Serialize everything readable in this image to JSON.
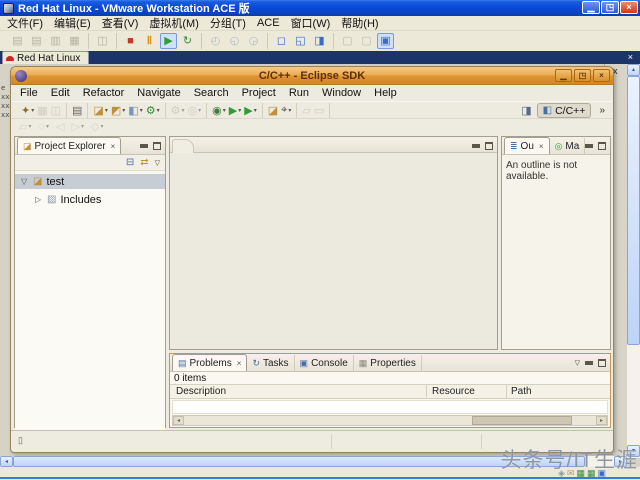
{
  "vmware": {
    "title": "Red Hat Linux - VMware Workstation ACE 版",
    "window_buttons": {
      "minimize": "▁",
      "restore": "◳",
      "close": "×"
    },
    "menu_items": [
      "文件(F)",
      "编辑(E)",
      "查看(V)",
      "虚拟机(M)",
      "分组(T)",
      "ACE",
      "窗口(W)",
      "帮助(H)"
    ],
    "toolbar": {
      "g1": [
        {
          "name": "vm-tool-icon-1",
          "glyph": "▤",
          "color": "#8a867a",
          "cls": "dim"
        },
        {
          "name": "vm-tool-icon-2",
          "glyph": "▤",
          "color": "#8a867a",
          "cls": "dim"
        },
        {
          "name": "vm-tool-icon-3",
          "glyph": "▥",
          "color": "#8a867a",
          "cls": "dim"
        },
        {
          "name": "vm-tool-icon-4",
          "glyph": "▦",
          "color": "#8a867a",
          "cls": "dim"
        }
      ],
      "g2": [
        {
          "name": "vm-settings-icon",
          "glyph": "◫",
          "color": "#8a867a",
          "cls": "dim"
        }
      ],
      "g3": [
        {
          "name": "power-off-button",
          "glyph": "■",
          "color": "#c23a28"
        },
        {
          "name": "suspend-button",
          "glyph": "Ⅱ",
          "color": "#e09a20",
          "cls": "boldg"
        },
        {
          "name": "power-on-button",
          "glyph": "▶",
          "color": "#2f9e33",
          "cls": "pressed"
        },
        {
          "name": "reset-button",
          "glyph": "↻",
          "color": "#3a8a3a"
        }
      ],
      "g4": [
        {
          "name": "snapshot-button",
          "glyph": "◴",
          "color": "#7a93b8",
          "cls": "dim"
        },
        {
          "name": "revert-snapshot-button",
          "glyph": "◵",
          "color": "#7a93b8",
          "cls": "dim"
        },
        {
          "name": "snapshot-manager-button",
          "glyph": "◶",
          "color": "#7a93b8",
          "cls": "dim"
        }
      ],
      "g5": [
        {
          "name": "fullscreen-button",
          "glyph": "◻",
          "color": "#3a6cc8"
        },
        {
          "name": "quick-switch-button",
          "glyph": "◱",
          "color": "#3a6cc8"
        },
        {
          "name": "unity-button",
          "glyph": "◨",
          "color": "#3a6cc8"
        }
      ],
      "g6": [
        {
          "name": "summary-view-button",
          "glyph": "▢",
          "color": "#9a968a",
          "cls": "dim"
        },
        {
          "name": "console-view-button",
          "glyph": "▢",
          "color": "#9a968a",
          "cls": "dim"
        },
        {
          "name": "appliance-view-button",
          "glyph": "▣",
          "color": "#3a6cc8",
          "cls": "pressed"
        }
      ]
    },
    "tab": {
      "label": "Red Hat Linux",
      "close_glyph": "×"
    }
  },
  "desktop": {
    "fragments": [
      "e",
      "xxd",
      "xxd",
      "xxd"
    ],
    "background_close_glyph": "x"
  },
  "eclipse": {
    "title": "C/C++ - Eclipse SDK",
    "window_buttons": {
      "minimize": "▁",
      "restore": "◳",
      "close": "×"
    },
    "menu_items": [
      "File",
      "Edit",
      "Refactor",
      "Navigate",
      "Search",
      "Project",
      "Run",
      "Window",
      "Help"
    ],
    "toolbar": {
      "m1": [
        {
          "name": "new-wizard-button",
          "glyph": "✦",
          "color": "#8a6d2f",
          "dd": "▾"
        },
        {
          "name": "save-button",
          "glyph": "▦",
          "color": "#b4b0a4",
          "cls": "dim"
        },
        {
          "name": "save-all-button",
          "glyph": "◫",
          "color": "#b4b0a4",
          "cls": "dim"
        }
      ],
      "m2": [
        {
          "name": "print-button",
          "glyph": "▤",
          "color": "#6a665a"
        }
      ],
      "m3": [
        {
          "name": "new-c-project-button",
          "glyph": "◪",
          "color": "#c09038",
          "dd": "▾"
        },
        {
          "name": "new-cpp-project-button",
          "glyph": "◩",
          "color": "#c09038",
          "dd": "▾"
        },
        {
          "name": "new-c-file-button",
          "glyph": "◧",
          "color": "#7a93b8",
          "dd": "▾"
        },
        {
          "name": "build-button",
          "glyph": "⚙",
          "color": "#3a8a3a",
          "dd": "▾"
        }
      ],
      "m4": [
        {
          "name": "wrench-icon",
          "glyph": "⚙",
          "color": "#b4b0a4",
          "cls": "dim",
          "dd": "▾"
        },
        {
          "name": "profile-icon",
          "glyph": "◎",
          "color": "#b4b0a4",
          "cls": "dim",
          "dd": "▾"
        }
      ],
      "m5": [
        {
          "name": "debug-button",
          "glyph": "◉",
          "color": "#3f7a3f",
          "dd": "▾"
        },
        {
          "name": "run-button",
          "glyph": "▶",
          "color": "#2f9e33",
          "dd": "▾"
        },
        {
          "name": "external-tools-button",
          "glyph": "▶",
          "color": "#2f9e33",
          "dd": "▾"
        }
      ],
      "m6": [
        {
          "name": "open-resource-button",
          "glyph": "◪",
          "color": "#c09038"
        },
        {
          "name": "search-button",
          "glyph": "⌖",
          "color": "#55514a",
          "dd": "▾"
        }
      ],
      "m7": [
        {
          "name": "next-annotation-button",
          "glyph": "▱",
          "color": "#b4b0a4",
          "cls": "dim"
        },
        {
          "name": "previous-annotation-button",
          "glyph": "▭",
          "color": "#b4b0a4",
          "cls": "dim"
        }
      ],
      "secondary": [
        {
          "name": "nav-icon-1",
          "glyph": "▱",
          "color": "#c0bcb0",
          "cls": "dim",
          "dd": "▾"
        },
        {
          "name": "nav-icon-2",
          "glyph": "◌",
          "color": "#c0bcb0",
          "cls": "dim",
          "dd": "▾"
        },
        {
          "name": "back-icon",
          "glyph": "◁",
          "color": "#c0bcb0",
          "cls": "dim"
        },
        {
          "name": "forward-icon",
          "glyph": "▷",
          "color": "#c0bcb0",
          "cls": "dim",
          "dd": "▾"
        },
        {
          "name": "nav-icon-3",
          "glyph": "◇",
          "color": "#c0bcb0",
          "cls": "dim",
          "dd": "▾"
        }
      ]
    },
    "perspective": {
      "open_glyph": "◨",
      "icon_glyph": "◧",
      "label": "C/C++",
      "chevron": "»"
    },
    "project_explorer": {
      "title": "Project Explorer",
      "close_glyph": "×",
      "toolbar": {
        "collapse_glyph": "⊟",
        "link_glyph": "⇄",
        "menu_glyph": "▽"
      },
      "tree": [
        {
          "name": "tree-item-test",
          "expander": "▽",
          "icon_glyph": "◪",
          "icon_color": "#c09038",
          "label": "test",
          "cls": "selected d0"
        },
        {
          "name": "tree-item-includes",
          "expander": "▷",
          "icon_glyph": "▨",
          "icon_color": "#8a96a8",
          "label": "Includes",
          "cls": "d1"
        }
      ]
    },
    "outline": {
      "tab1": {
        "icon": "≣",
        "label": "Ou",
        "close": "×"
      },
      "tab2": {
        "icon": "◎",
        "label": "Ma"
      },
      "message": "An outline is not available."
    },
    "bottom_panel": {
      "tabs": [
        {
          "name": "tab-problems",
          "icon": "▤",
          "color": "#4a6da8",
          "label": "Problems",
          "close": "×",
          "cls": "active"
        },
        {
          "name": "tab-tasks",
          "icon": "↻",
          "color": "#4a6da8",
          "label": "Tasks"
        },
        {
          "name": "tab-console",
          "icon": "▣",
          "color": "#4a6da8",
          "label": "Console"
        },
        {
          "name": "tab-properties",
          "icon": "▦",
          "color": "#8a867a",
          "label": "Properties"
        }
      ],
      "menu_glyph": "▽",
      "status": "0 items",
      "columns": [
        "Description",
        "Resource",
        "Path"
      ]
    },
    "status_icon_glyph": "▯"
  },
  "scroll": {
    "up": "▴",
    "down": "▾",
    "left": "◂",
    "right": "▸"
  },
  "tray": [
    {
      "name": "lock-icon",
      "glyph": "◈",
      "color": "#8a96a8"
    },
    {
      "name": "mail-icon",
      "glyph": "✉",
      "color": "#b09a6a"
    },
    {
      "name": "nic-icon-1",
      "glyph": "▦",
      "color": "#3a8a3a"
    },
    {
      "name": "nic-icon-2",
      "glyph": "▦",
      "color": "#3a8a3a"
    },
    {
      "name": "usb-icon",
      "glyph": "▣",
      "color": "#3a6ac8"
    }
  ],
  "watermark": "头条号/IT生涯",
  "colors": {
    "xp_titlebar_blue": "#0a4ad8",
    "vm_tabbar_navy": "#1d3468",
    "eclipse_titlebar_orange": "#e39a3c",
    "desktop_gray": "#d6d2c6",
    "tree_selection": "#c6cdd4",
    "bottom_panel_border": "#c09858"
  }
}
